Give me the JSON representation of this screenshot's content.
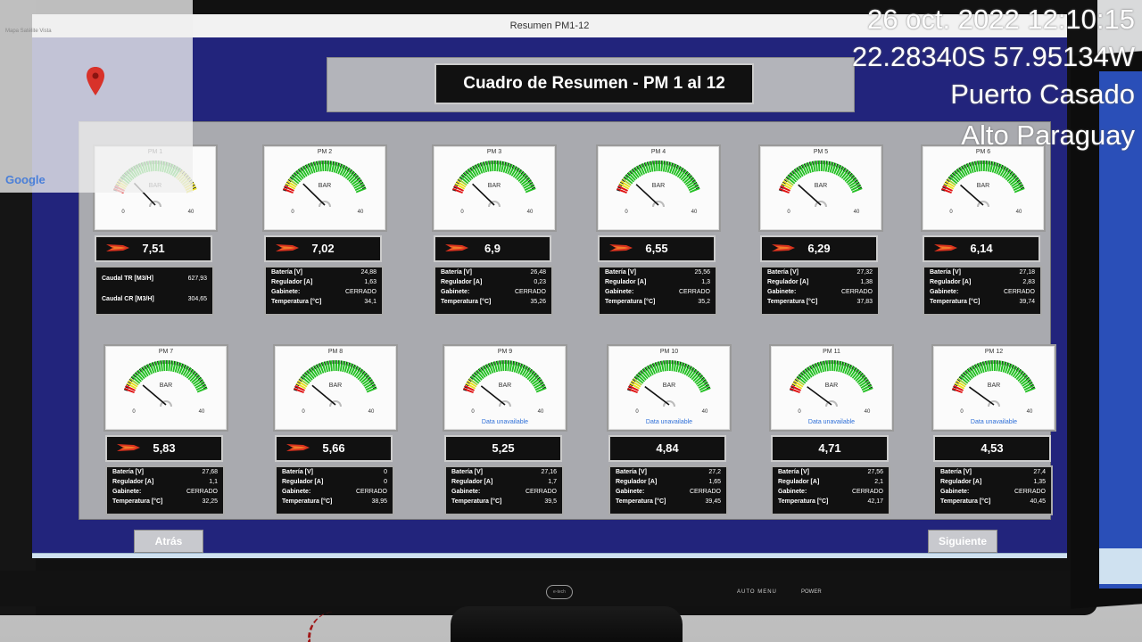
{
  "window": {
    "title": "Resumen PM1-12"
  },
  "header": {
    "title": "Cuadro de Resumen - PM 1 al 12"
  },
  "gauges": [
    {
      "label": "PM 1",
      "unit": "BAR",
      "min": "0",
      "max": "40",
      "reading": 7.51,
      "value": "7,51",
      "flame": true,
      "unavailable": "",
      "info": [
        [
          "Caudal TR [M3/H]",
          "627,93"
        ],
        [
          "Caudal CR [M3/H]",
          "304,65"
        ]
      ]
    },
    {
      "label": "PM 2",
      "unit": "BAR",
      "min": "0",
      "max": "40",
      "reading": 7.02,
      "value": "7,02",
      "flame": true,
      "unavailable": "",
      "info": [
        [
          "Batería [V]",
          "24,88"
        ],
        [
          "Regulador [A]",
          "1,63"
        ],
        [
          "Gabinete:",
          "CERRADO"
        ],
        [
          "Temperatura [°C]",
          "34,1"
        ]
      ]
    },
    {
      "label": "PM 3",
      "unit": "BAR",
      "min": "0",
      "max": "40",
      "reading": 6.9,
      "value": "6,9",
      "flame": true,
      "unavailable": "",
      "info": [
        [
          "Batería [V]",
          "26,48"
        ],
        [
          "Regulador [A]",
          "0,23"
        ],
        [
          "Gabinete:",
          "CERRADO"
        ],
        [
          "Temperatura [°C]",
          "35,26"
        ]
      ]
    },
    {
      "label": "PM 4",
      "unit": "BAR",
      "min": "0",
      "max": "40",
      "reading": 6.55,
      "value": "6,55",
      "flame": true,
      "unavailable": "",
      "info": [
        [
          "Batería [V]",
          "25,56"
        ],
        [
          "Regulador [A]",
          "1,3"
        ],
        [
          "Gabinete:",
          "CERRADO"
        ],
        [
          "Temperatura [°C]",
          "35,2"
        ]
      ]
    },
    {
      "label": "PM 5",
      "unit": "BAR",
      "min": "0",
      "max": "40",
      "reading": 6.29,
      "value": "6,29",
      "flame": true,
      "unavailable": "",
      "info": [
        [
          "Batería [V]",
          "27,32"
        ],
        [
          "Regulador [A]",
          "1,38"
        ],
        [
          "Gabinete:",
          "CERRADO"
        ],
        [
          "Temperatura [°C]",
          "37,83"
        ]
      ]
    },
    {
      "label": "PM 6",
      "unit": "BAR",
      "min": "0",
      "max": "40",
      "reading": 6.14,
      "value": "6,14",
      "flame": true,
      "unavailable": "",
      "info": [
        [
          "Batería [V]",
          "27,18"
        ],
        [
          "Regulador [A]",
          "2,83"
        ],
        [
          "Gabinete:",
          "CERRADO"
        ],
        [
          "Temperatura [°C]",
          "39,74"
        ]
      ]
    },
    {
      "label": "PM 7",
      "unit": "BAR",
      "min": "0",
      "max": "40",
      "reading": 5.83,
      "value": "5,83",
      "flame": true,
      "unavailable": "",
      "info": [
        [
          "Batería [V]",
          "27,68"
        ],
        [
          "Regulador [A]",
          "1,1"
        ],
        [
          "Gabinete:",
          "CERRADO"
        ],
        [
          "Temperatura [°C]",
          "32,25"
        ]
      ]
    },
    {
      "label": "PM 8",
      "unit": "BAR",
      "min": "0",
      "max": "40",
      "reading": 5.66,
      "value": "5,66",
      "flame": true,
      "unavailable": "",
      "info": [
        [
          "Batería [V]",
          "0"
        ],
        [
          "Regulador [A]",
          "0"
        ],
        [
          "Gabinete:",
          "CERRADO"
        ],
        [
          "Temperatura [°C]",
          "38,95"
        ]
      ]
    },
    {
      "label": "PM 9",
      "unit": "BAR",
      "min": "0",
      "max": "40",
      "reading": 5.25,
      "value": "5,25",
      "flame": false,
      "unavailable": "Data unavailable",
      "info": [
        [
          "Batería [V]",
          "27,16"
        ],
        [
          "Regulador [A]",
          "1,7"
        ],
        [
          "Gabinete:",
          "CERRADO"
        ],
        [
          "Temperatura [°C]",
          "39,5"
        ]
      ]
    },
    {
      "label": "PM 10",
      "unit": "BAR",
      "min": "0",
      "max": "40",
      "reading": 4.84,
      "value": "4,84",
      "flame": false,
      "unavailable": "Data unavailable",
      "info": [
        [
          "Batería [V]",
          "27,2"
        ],
        [
          "Regulador [A]",
          "1,65"
        ],
        [
          "Gabinete:",
          "CERRADO"
        ],
        [
          "Temperatura [°C]",
          "39,45"
        ]
      ]
    },
    {
      "label": "PM 11",
      "unit": "BAR",
      "min": "0",
      "max": "40",
      "reading": 4.71,
      "value": "4,71",
      "flame": false,
      "unavailable": "Data unavailable",
      "info": [
        [
          "Batería [V]",
          "27,56"
        ],
        [
          "Regulador [A]",
          "2,1"
        ],
        [
          "Gabinete:",
          "CERRADO"
        ],
        [
          "Temperatura [°C]",
          "42,17"
        ]
      ]
    },
    {
      "label": "PM 12",
      "unit": "BAR",
      "min": "0",
      "max": "40",
      "reading": 4.53,
      "value": "4,53",
      "flame": false,
      "unavailable": "Data unavailable",
      "info": [
        [
          "Batería [V]",
          "27,4"
        ],
        [
          "Regulador [A]",
          "1,35"
        ],
        [
          "Gabinete:",
          "CERRADO"
        ],
        [
          "Temperatura [°C]",
          "40,45"
        ]
      ]
    }
  ],
  "nav": {
    "back": "Atrás",
    "next": "Siguiente"
  },
  "monitor": {
    "auto_menu": "AUTO MENU",
    "power": "POWER",
    "brand": "e-tech"
  },
  "map": {
    "brand": "Google",
    "menu": "Mapa  Satélite  Vista"
  },
  "overlay": {
    "datetime": "26 oct. 2022 12:10:15",
    "coords": "22.28340S 57.95134W",
    "city": "Puerto Casado",
    "region": "Alto Paraguay"
  },
  "colors": {
    "screen_bg": "#22247c",
    "gauge_green": "#22c022",
    "gauge_red": "#e01010",
    "gauge_yellow": "#e8e020"
  }
}
